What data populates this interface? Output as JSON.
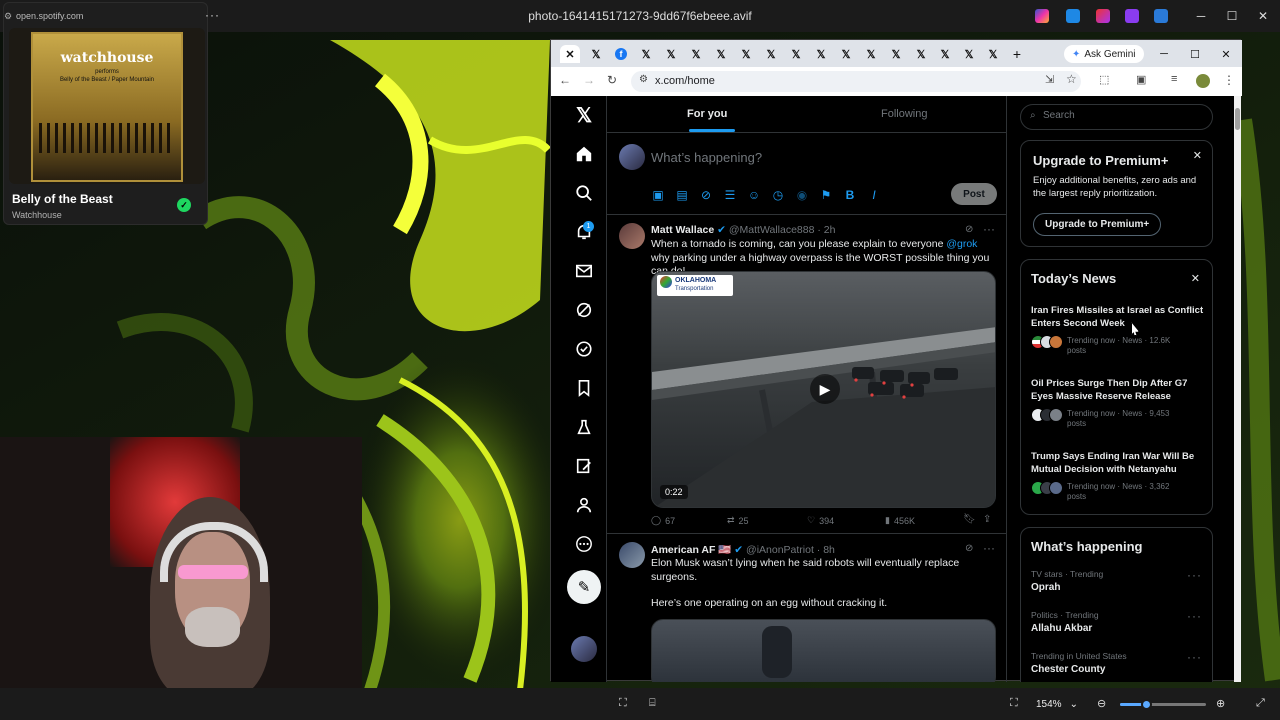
{
  "os": {
    "image_title": "photo-1641415171273-9dd67f6ebeee.avif"
  },
  "spotify": {
    "url": "open.spotify.com",
    "album_art_title": "watchhouse",
    "album_art_sub1": "performs",
    "album_art_sub2": "Belly of the Beast / Paper Mountain",
    "track_title": "Belly of the Beast",
    "artist": "Watchhouse"
  },
  "browser": {
    "tab_count": 17,
    "ask_gemini": "Ask Gemini",
    "url": "x.com/home"
  },
  "x": {
    "nav": [
      "home-icon",
      "search-icon",
      "notifications-icon",
      "messages-icon",
      "grok-icon",
      "verified-icon",
      "bookmarks-icon",
      "jobs-icon",
      "communities-icon",
      "profile-icon",
      "more-icon"
    ],
    "notification_badge": "1",
    "tabs": {
      "for_you": "For you",
      "following": "Following"
    },
    "compose_placeholder": "What’s happening?",
    "post_button": "Post",
    "tweets": [
      {
        "name": "Matt Wallace",
        "handle": "@MattWallace888 · 2h",
        "text_before": "When a tornado is coming, can you please explain to everyone ",
        "mention": "@grok",
        "text_after": " why parking under a highway overpass is the WORST possible thing you can do!",
        "media_logo_top": "OKLAHOMA",
        "media_logo_bottom": "Transportation",
        "duration": "0:22",
        "replies": "67",
        "reposts": "25",
        "likes": "394",
        "views": "456K"
      },
      {
        "name": "American AF 🇺🇸",
        "handle": "@iAnonPatriot · 8h",
        "text1": "Elon Musk wasn’t lying when he said robots will eventually replace surgeons.",
        "text2": "Here’s one operating on an egg without cracking it."
      }
    ],
    "search_placeholder": "Search",
    "premium": {
      "title": "Upgrade to Premium+",
      "body": "Enjoy additional benefits, zero ads and the largest reply prioritization.",
      "button": "Upgrade to Premium+"
    },
    "news": {
      "title": "Today’s News",
      "items": [
        {
          "headline": "Iran Fires Missiles at Israel as Conflict Enters Second Week",
          "meta": "Trending now · News · 12.6K posts"
        },
        {
          "headline": "Oil Prices Surge Then Dip After G7 Eyes Massive Reserve Release",
          "meta": "Trending now · News · 9,453 posts"
        },
        {
          "headline": "Trump Says Ending Iran War Will Be Mutual Decision with Netanyahu",
          "meta": "Trending now · News · 3,362 posts"
        }
      ]
    },
    "happening": {
      "title": "What’s happening",
      "trends": [
        {
          "context": "TV stars · Trending",
          "name": "Oprah"
        },
        {
          "context": "Politics · Trending",
          "name": "Allahu Akbar"
        },
        {
          "context": "Trending in United States",
          "name": "Chester County"
        }
      ]
    }
  },
  "viewer": {
    "zoom": "154%",
    "zoom_fraction": 0.3
  },
  "colors": {
    "x_blue": "#1d9bf0",
    "spotify_green": "#1ed760"
  }
}
